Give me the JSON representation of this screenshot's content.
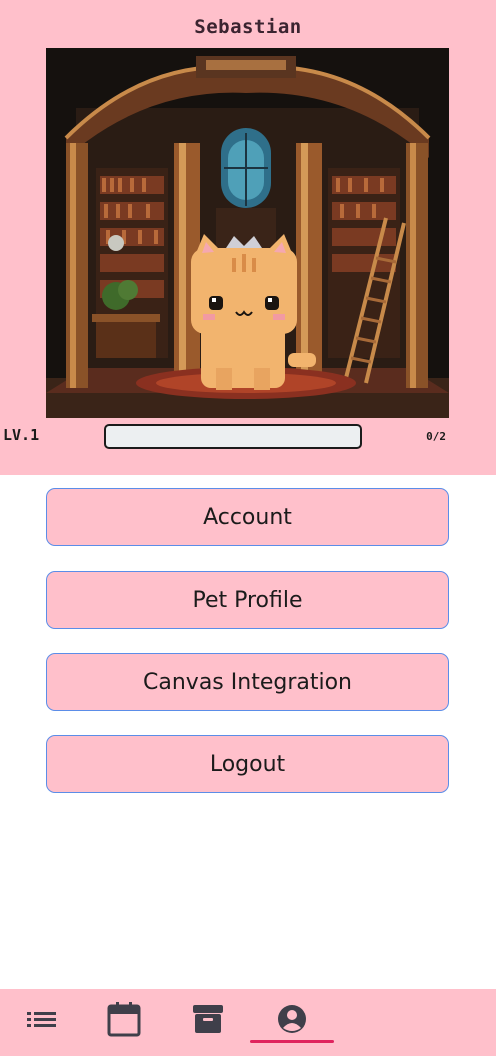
{
  "pet": {
    "name": "Sebastian",
    "level_label": "LV.1",
    "xp_text": "0/2",
    "xp_progress": 0
  },
  "menu": {
    "account_label": "Account",
    "pet_profile_label": "Pet Profile",
    "canvas_integration_label": "Canvas Integration",
    "logout_label": "Logout"
  },
  "nav": {
    "items": [
      {
        "icon": "list-icon"
      },
      {
        "icon": "calendar-icon"
      },
      {
        "icon": "archive-icon"
      },
      {
        "icon": "account-circle-icon",
        "active": true
      }
    ]
  },
  "colors": {
    "panel_pink": "#ffc0cb",
    "button_border": "#5b8de8",
    "active_indicator": "#e0245e",
    "icon_dark": "#3f3f4a"
  }
}
